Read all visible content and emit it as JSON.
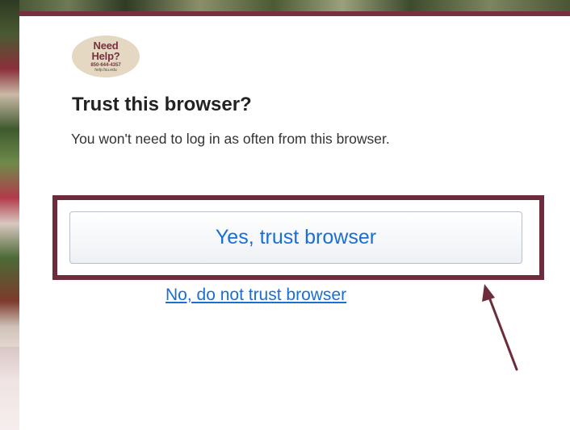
{
  "logo": {
    "line1": "Need",
    "line2": "Help?",
    "phone": "850-644-4357",
    "url": "help.fsu.edu"
  },
  "dialog": {
    "title": "Trust this browser?",
    "subtitle": "You won't need to log in as often from this browser.",
    "trust_button_label": "Yes, trust browser",
    "no_trust_link_label": "No, do not trust browser"
  },
  "colors": {
    "accent": "#782f40",
    "link": "#1a6fd6",
    "annotation": "#6e2b3b"
  },
  "annotations": {
    "highlight_target": "trust-button",
    "arrow_icon": "arrow-annotation-icon"
  }
}
